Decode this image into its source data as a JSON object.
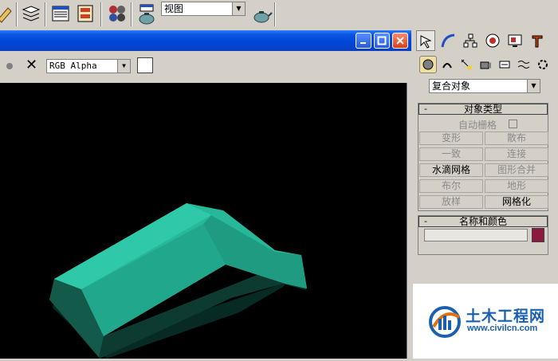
{
  "toolbar": {
    "view_dropdown": "视图",
    "icons": [
      "ruler-icon",
      "layers-icon",
      "curve-editor-icon",
      "schematic-icon",
      "material-editor-icon",
      "render-scene-icon",
      "quick-render-icon",
      "quick-render-teapot-icon"
    ]
  },
  "viewport_window": {
    "title": "",
    "buttons": [
      "minimize-icon",
      "maximize-icon",
      "close-icon"
    ],
    "channel_dropdown": "RGB Alpha"
  },
  "command_panel": {
    "tabs": [
      "create-icon",
      "modify-icon",
      "hierarchy-icon",
      "motion-icon",
      "display-icon",
      "utilities-icon"
    ],
    "subcategories": [
      "geometry-icon",
      "shapes-icon",
      "lights-icon",
      "cameras-icon",
      "helpers-icon",
      "spacewarps-icon",
      "systems-icon"
    ],
    "category_dropdown": "复合对象",
    "object_type": {
      "header": "对象类型",
      "collapse": "-",
      "autogrid_label": "自动栅格",
      "buttons": [
        {
          "label": "变形",
          "enabled": false
        },
        {
          "label": "散布",
          "enabled": false
        },
        {
          "label": "一致",
          "enabled": false
        },
        {
          "label": "连接",
          "enabled": false
        },
        {
          "label": "水滴网格",
          "enabled": true
        },
        {
          "label": "图形合并",
          "enabled": false
        },
        {
          "label": "布尔",
          "enabled": false
        },
        {
          "label": "地形",
          "enabled": false
        },
        {
          "label": "放样",
          "enabled": false
        },
        {
          "label": "网格化",
          "enabled": true
        }
      ]
    },
    "name_color": {
      "header": "名称和颜色",
      "collapse": "-",
      "name_value": "",
      "color": "#8b1a3e"
    }
  },
  "watermark": {
    "title": "土木工程网",
    "url": "www.civilcn.com"
  },
  "colors": {
    "object_light": "#2dbfa0",
    "object_dark": "#0f5a4a",
    "titlebar": "#0a4fd8"
  }
}
